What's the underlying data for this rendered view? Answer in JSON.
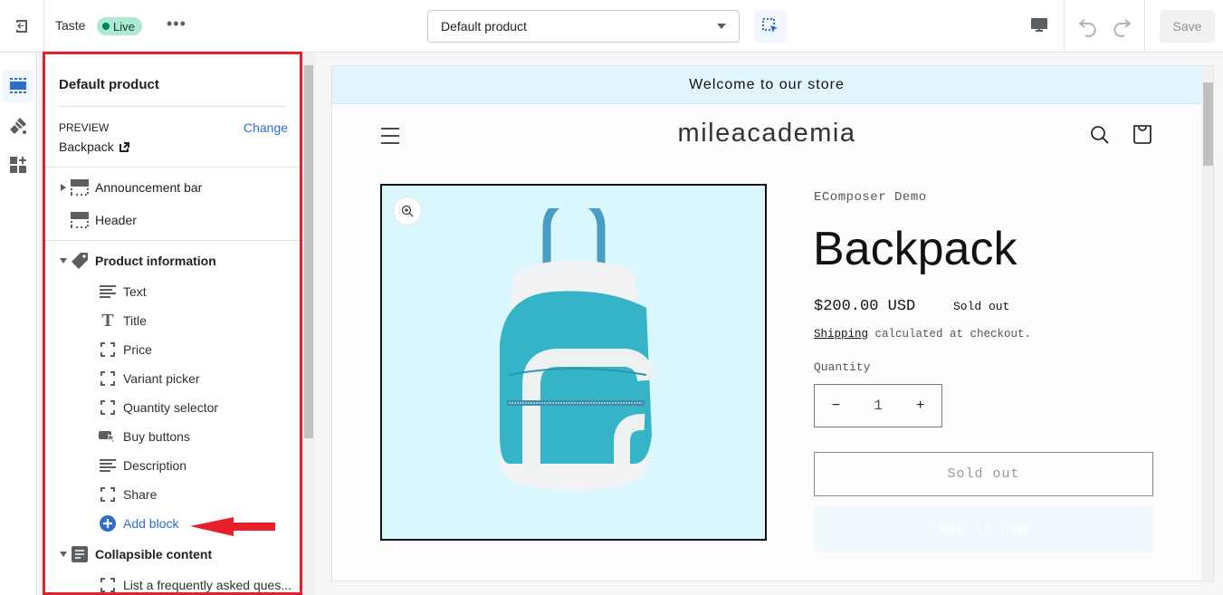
{
  "topbar": {
    "theme_name": "Taste",
    "status_badge": "Live",
    "template_select": "Default product",
    "save_label": "Save"
  },
  "panel": {
    "title": "Default product",
    "preview_label": "PREVIEW",
    "change_link": "Change",
    "preview_value": "Backpack",
    "sections": [
      {
        "label": "Announcement bar",
        "icon": "section-icon",
        "expanded": false
      },
      {
        "label": "Header",
        "icon": "section-icon"
      },
      {
        "label": "Product information",
        "icon": "tag-icon",
        "expanded": true
      },
      {
        "label": "Collapsible content",
        "icon": "list-icon",
        "expanded": true
      }
    ],
    "blocks": [
      {
        "label": "Text",
        "icon": "text-lines-icon"
      },
      {
        "label": "Title",
        "icon": "title-icon"
      },
      {
        "label": "Price",
        "icon": "dashed-box-icon"
      },
      {
        "label": "Variant picker",
        "icon": "dashed-box-icon"
      },
      {
        "label": "Quantity selector",
        "icon": "dashed-box-icon"
      },
      {
        "label": "Buy buttons",
        "icon": "button-cursor-icon"
      },
      {
        "label": "Description",
        "icon": "text-lines-icon"
      },
      {
        "label": "Share",
        "icon": "dashed-box-icon"
      }
    ],
    "add_block": "Add block",
    "collapsible_blocks": [
      {
        "label": "List a frequently asked ques...",
        "icon": "dashed-box-icon"
      }
    ]
  },
  "store": {
    "announcement": "Welcome to our store",
    "logo": "mileacademia",
    "vendor": "EComposer Demo",
    "product_title": "Backpack",
    "price": "$200.00 USD",
    "sold_badge": "Sold out",
    "shipping_link": "Shipping",
    "shipping_text": " calculated at checkout.",
    "quantity_label": "Quantity",
    "quantity_value": "1",
    "minus": "−",
    "plus": "+",
    "sold_out_button": "Sold out",
    "buy_now_button": "Buy it now"
  },
  "colors": {
    "accent": "#2c6ecb",
    "live_badge_bg": "#aee9d1",
    "highlight_border": "#e5202a",
    "announcement_bg": "#e2f5fe",
    "media_bg": "#dbf7fe"
  }
}
